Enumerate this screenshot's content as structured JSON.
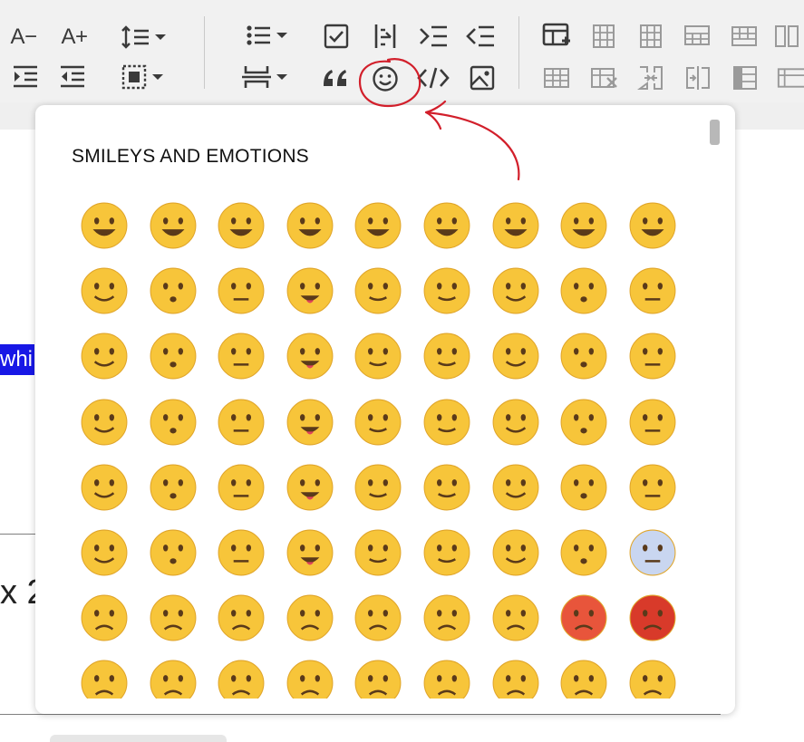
{
  "toolbar": {
    "row1": [
      {
        "name": "decrease-font-size-button",
        "label": "A−"
      },
      {
        "name": "increase-font-size-button",
        "label": "A+"
      },
      {
        "name": "line-height-button",
        "icon": "line-height-icon"
      },
      {
        "name": "bulleted-list-button",
        "icon": "bulleted-list-icon"
      },
      {
        "name": "checklist-button",
        "icon": "checklist-icon"
      },
      {
        "name": "text-direction-button",
        "icon": "text-direction-icon"
      },
      {
        "name": "indent-button",
        "icon": "indent-icon"
      },
      {
        "name": "outdent-button",
        "icon": "outdent-icon"
      },
      {
        "name": "insert-table-button",
        "icon": "insert-table-icon"
      },
      {
        "name": "table-column-before-button",
        "icon": "table-column-icon"
      },
      {
        "name": "table-column-after-button",
        "icon": "table-column-icon"
      },
      {
        "name": "table-row-above-button",
        "icon": "table-row-icon"
      },
      {
        "name": "table-row-below-button",
        "icon": "table-row-icon"
      },
      {
        "name": "table-delete-column-button",
        "icon": "table-delete-icon"
      }
    ],
    "row2": [
      {
        "name": "increase-indent-button",
        "icon": "increase-indent-icon"
      },
      {
        "name": "decrease-indent-button",
        "icon": "decrease-indent-icon"
      },
      {
        "name": "block-style-button",
        "icon": "block-style-icon"
      },
      {
        "name": "horizontal-rule-button",
        "icon": "horizontal-rule-icon"
      },
      {
        "name": "blockquote-button",
        "icon": "quote-icon"
      },
      {
        "name": "emoji-button",
        "icon": "smiley-icon"
      },
      {
        "name": "code-button",
        "icon": "code-icon"
      },
      {
        "name": "insert-image-button",
        "icon": "image-icon"
      },
      {
        "name": "table-properties-button",
        "icon": "table-icon"
      },
      {
        "name": "table-delete-button",
        "icon": "table-delete-icon"
      },
      {
        "name": "merge-cells-button",
        "icon": "merge-cells-icon"
      },
      {
        "name": "split-cells-button",
        "icon": "split-cells-icon"
      },
      {
        "name": "table-header-button",
        "icon": "table-header-icon"
      },
      {
        "name": "table-more-button",
        "icon": "table-icon"
      }
    ]
  },
  "editor": {
    "selected_text": "whi",
    "body_text": "x 2"
  },
  "emoji_picker": {
    "title": "SMILEYS AND EMOTIONS",
    "emojis": [
      "😀",
      "😃",
      "😄",
      "😁",
      "😆",
      "😅",
      "😂",
      "🤣",
      "😭",
      "😉",
      "😗",
      "😙",
      "😚",
      "😘",
      "🥰",
      "😍",
      "🤩",
      "🥳",
      "🫠",
      "🙃",
      "🙂",
      "🥲",
      "🥹",
      "😊",
      "☺️",
      "😌",
      "😔",
      "😮‍💨",
      "😏",
      "🤤",
      "😋",
      "😛",
      "😝",
      "😜",
      "🤪",
      "🥴",
      "😔",
      "🥺",
      "😬",
      "😑",
      "😐",
      "😶",
      "😶‍🌫️",
      "🫥",
      "🤐",
      "🫡",
      "🤔",
      "🤫",
      "🫢",
      "🤭",
      "🥱",
      "🤗",
      "🫣",
      "😱",
      "🤨",
      "🧐",
      "😒",
      "🙄",
      "😤",
      "😤",
      "😠",
      "😡",
      "🤬",
      "😞",
      "😓",
      "😟",
      "😥",
      "😢",
      "☹️",
      "🙁",
      "🫤",
      "😕"
    ]
  },
  "colors": {
    "toolbar_bg": "#f1f1f1",
    "selection": "#1717e6",
    "annotation": "#d21f2b",
    "emoji_face": "#f7c53a"
  }
}
